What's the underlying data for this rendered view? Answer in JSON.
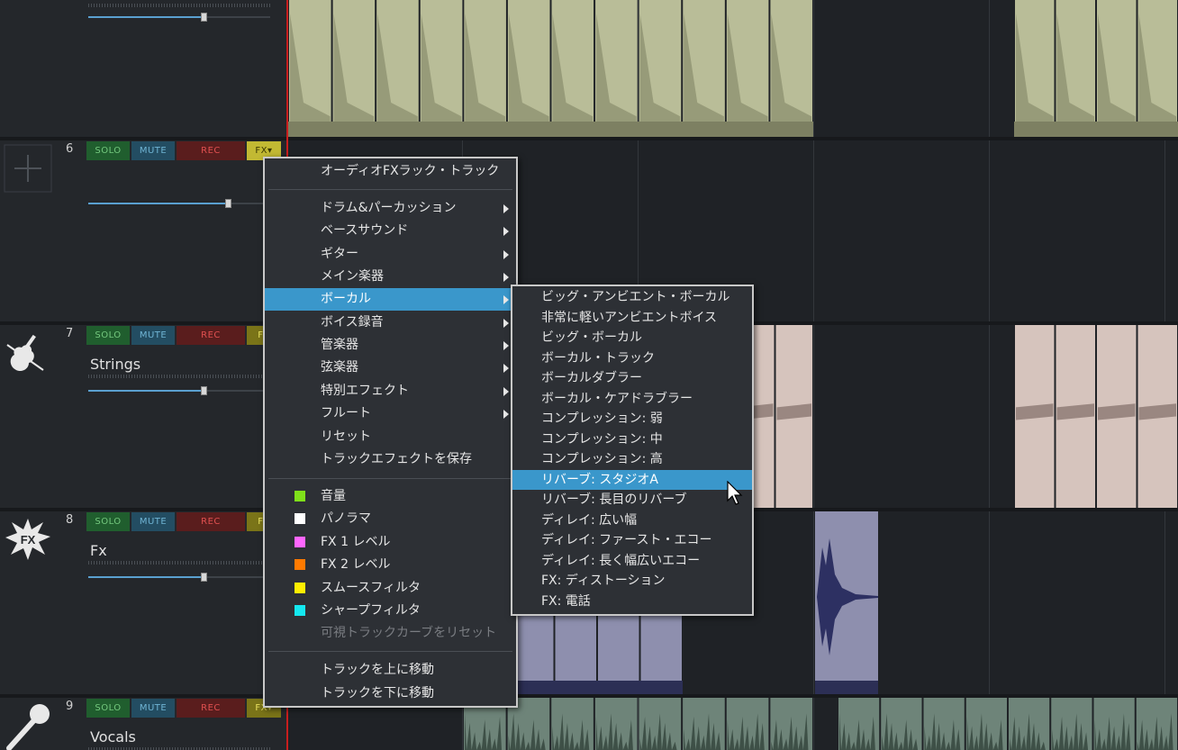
{
  "tracks": [
    {
      "number": "",
      "name": "",
      "volume": 0.64
    },
    {
      "number": "6",
      "name": "",
      "volume": 0.77,
      "icon": "empty-track-plus-icon"
    },
    {
      "number": "7",
      "name": "Strings",
      "volume": 0.64,
      "icon": "violin-icon"
    },
    {
      "number": "8",
      "name": "Fx",
      "volume": 0.64,
      "icon": "fx-burst-icon"
    },
    {
      "number": "9",
      "name": "Vocals",
      "volume": 0.64,
      "icon": "microphone-icon"
    }
  ],
  "buttons": {
    "solo": "SOLO",
    "mute": "MUTE",
    "rec": "REC",
    "fx": "FX"
  },
  "context_menu": {
    "items": [
      {
        "label": "オーディオFXラック・トラック",
        "submenu": false
      },
      {
        "label": "ドラム&パーカッション",
        "submenu": true
      },
      {
        "label": "ベースサウンド",
        "submenu": true
      },
      {
        "label": "ギター",
        "submenu": true
      },
      {
        "label": "メイン楽器",
        "submenu": true
      },
      {
        "label": "ボーカル",
        "submenu": true,
        "highlighted": true
      },
      {
        "label": "ボイス録音",
        "submenu": true
      },
      {
        "label": "管楽器",
        "submenu": true
      },
      {
        "label": "弦楽器",
        "submenu": true
      },
      {
        "label": "特別エフェクト",
        "submenu": true
      },
      {
        "label": "フルート",
        "submenu": true
      },
      {
        "label": "リセット",
        "submenu": false
      },
      {
        "label": "トラックエフェクトを保存",
        "submenu": false
      },
      {
        "label": "音量",
        "swatch": "#7fe01a"
      },
      {
        "label": "パノラマ",
        "swatch": "#ffffff"
      },
      {
        "label": "FX 1 レベル",
        "swatch": "#ff66ff"
      },
      {
        "label": "FX 2 レベル",
        "swatch": "#ff7a00"
      },
      {
        "label": "スムースフィルタ",
        "swatch": "#ffee00"
      },
      {
        "label": "シャープフィルタ",
        "swatch": "#14e8f0"
      },
      {
        "label": "可視トラックカーブをリセット",
        "disabled": true
      },
      {
        "label": "トラックを上に移動"
      },
      {
        "label": "トラックを下に移動"
      }
    ]
  },
  "submenu": {
    "items": [
      {
        "label": "ビッグ・アンビエント・ボーカル"
      },
      {
        "label": "非常に軽いアンビエントボイス"
      },
      {
        "label": "ビッグ・ボーカル"
      },
      {
        "label": "ボーカル・トラック"
      },
      {
        "label": "ボーカルダブラー"
      },
      {
        "label": "ボーカル・ケアドラブラー"
      },
      {
        "label": "コンプレッション: 弱"
      },
      {
        "label": "コンプレッション: 中"
      },
      {
        "label": "コンプレッション: 高"
      },
      {
        "label": "リバーブ: スタジオA",
        "highlighted": true
      },
      {
        "label": "リバーブ: 長目のリバーブ"
      },
      {
        "label": "ディレイ: 広い幅"
      },
      {
        "label": "ディレイ: ファースト・エコー"
      },
      {
        "label": "ディレイ: 長く幅広いエコー"
      },
      {
        "label": "FX: ディストーション"
      },
      {
        "label": "FX: 電話"
      }
    ]
  },
  "colors": {
    "clip_drums": "#b9bd98",
    "clip_strings": "#d6c4bd",
    "clip_fx": "#8e8fae",
    "clip_vocals": "#6e8479",
    "highlight": "#3a97cb"
  }
}
